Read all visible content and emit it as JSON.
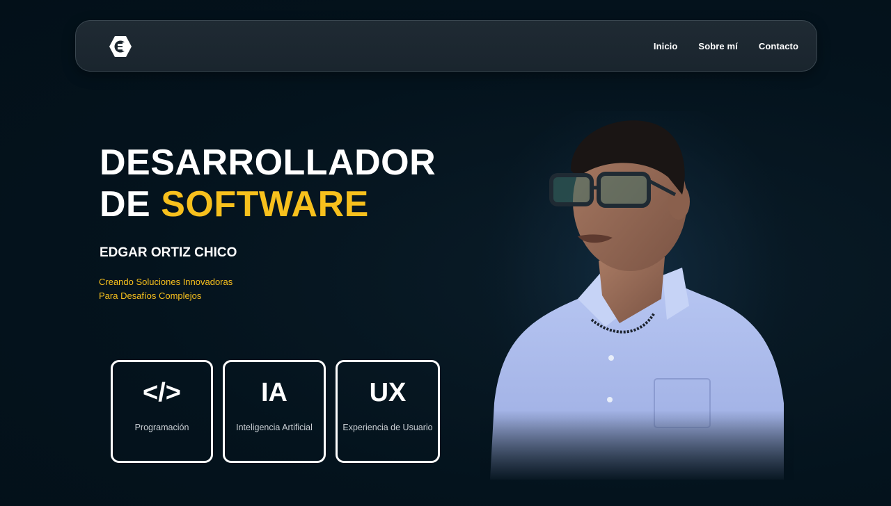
{
  "nav": {
    "logo_icon": "hexagon-e-logo-icon",
    "links": [
      "Inicio",
      "Sobre mí",
      "Contacto"
    ]
  },
  "hero": {
    "title_line1": "DESARROLLADOR",
    "title_line2_prefix": "DE ",
    "title_line2_accent": "SOFTWARE",
    "name": "EDGAR ORTIZ CHICO",
    "tagline_line1": "Creando Soluciones Innovadoras",
    "tagline_line2": "Para Desafíos Complejos"
  },
  "cards": [
    {
      "icon_text": "</>",
      "label": "Programación",
      "icon": "code-icon"
    },
    {
      "icon_text": "IA",
      "label": "Inteligencia Artificial",
      "icon": "ai-icon"
    },
    {
      "icon_text": "UX",
      "label": "Experiencia de Usuario",
      "icon": "ux-icon"
    }
  ],
  "colors": {
    "background": "#03121c",
    "navbar": "#1d2830",
    "accent": "#f7c01d",
    "text": "#ffffff",
    "card_label": "#c9cfd4",
    "shirt": "#a9b9ee"
  }
}
